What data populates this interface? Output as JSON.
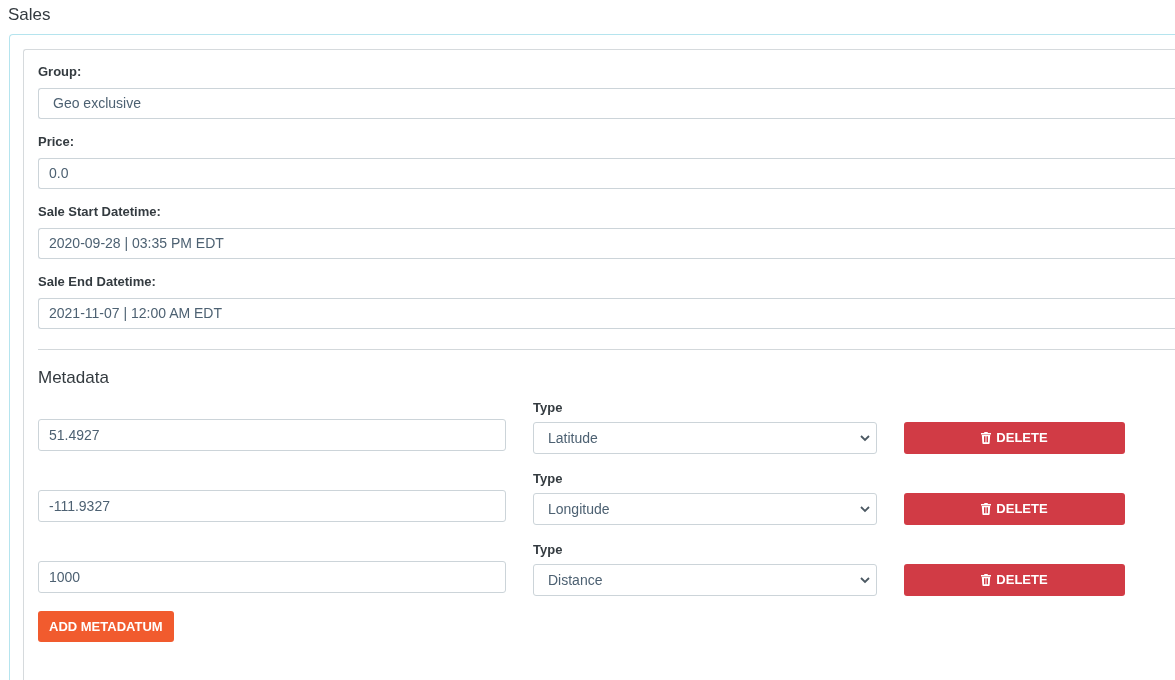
{
  "page": {
    "title": "Sales"
  },
  "fields": [
    {
      "kind": "select",
      "label": "Group:",
      "value": "Geo exclusive"
    },
    {
      "kind": "input",
      "label": "Price:",
      "value": "0.0"
    },
    {
      "kind": "input",
      "label": "Sale Start Datetime:",
      "value": "2020-09-28 | 03:35 PM EDT"
    },
    {
      "kind": "input",
      "label": "Sale End Datetime:",
      "value": "2021-11-07 | 12:00 AM EDT"
    }
  ],
  "metadata": {
    "title": "Metadata",
    "rows": [
      {
        "value": "51.4927",
        "type_label": "Type",
        "type": "Latitude",
        "delete": "DELETE"
      },
      {
        "value": "-111.9327",
        "type_label": "Type",
        "type": "Longitude",
        "delete": "DELETE"
      },
      {
        "value": "1000",
        "type_label": "Type",
        "type": "Distance",
        "delete": "DELETE"
      }
    ],
    "add_button": "ADD METADATUM"
  }
}
